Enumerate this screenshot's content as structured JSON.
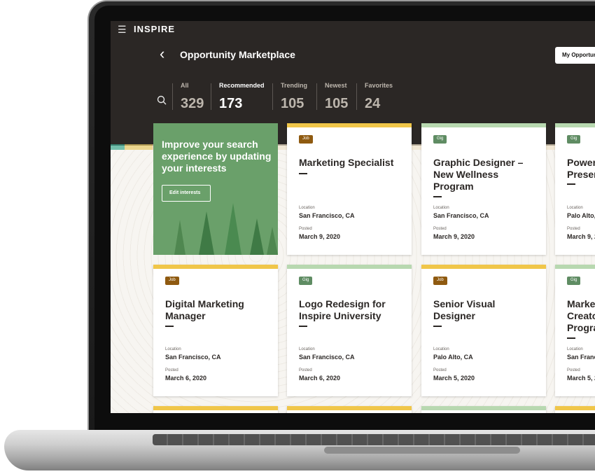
{
  "app": {
    "logo": "INSPIRE",
    "menu_icon": "hamburger-icon"
  },
  "header": {
    "back_icon": "chevron-left-icon",
    "title": "Opportunity Marketplace",
    "my_opportunities_label": "My Opportun"
  },
  "filters": [
    {
      "label": "All",
      "count": "329"
    },
    {
      "label": "Recommended",
      "count": "173"
    },
    {
      "label": "Trending",
      "count": "105"
    },
    {
      "label": "Newest",
      "count": "105"
    },
    {
      "label": "Favorites",
      "count": "24"
    }
  ],
  "promo": {
    "text": "Improve your search experience by updating your interests",
    "button_label": "Edit interests"
  },
  "labels": {
    "location": "Location",
    "posted": "Posted"
  },
  "cards": [
    {
      "badge": "Job",
      "title": "Marketing Specialist",
      "location": "San Francisco, CA",
      "posted": "March 9, 2020"
    },
    {
      "badge": "Gig",
      "title": "Graphic Designer – New Wellness Program",
      "location": "San Francisco, CA",
      "posted": "March 9, 2020"
    },
    {
      "badge": "Gig",
      "title": "Power Presen",
      "location": "Palo Alto,",
      "posted": "March 9, 2"
    },
    {
      "badge": "Job",
      "title": "Digital Marketing Manager",
      "location": "San Francisco, CA",
      "posted": "March 6, 2020"
    },
    {
      "badge": "Gig",
      "title": "Logo Redesign for Inspire University",
      "location": "San Francisco, CA",
      "posted": "March 6, 2020"
    },
    {
      "badge": "Job",
      "title": "Senior Visual Designer",
      "location": "Palo Alto, CA",
      "posted": "March 5, 2020"
    },
    {
      "badge": "Gig",
      "title": "Marke Creato Progra",
      "location": "San Franc",
      "posted": "March 5, 2"
    }
  ],
  "colors": {
    "header_bg": "#2b2725",
    "job_accent": "#f0c649",
    "gig_accent": "#b8d8b0",
    "promo_bg": "#6aa06a"
  }
}
